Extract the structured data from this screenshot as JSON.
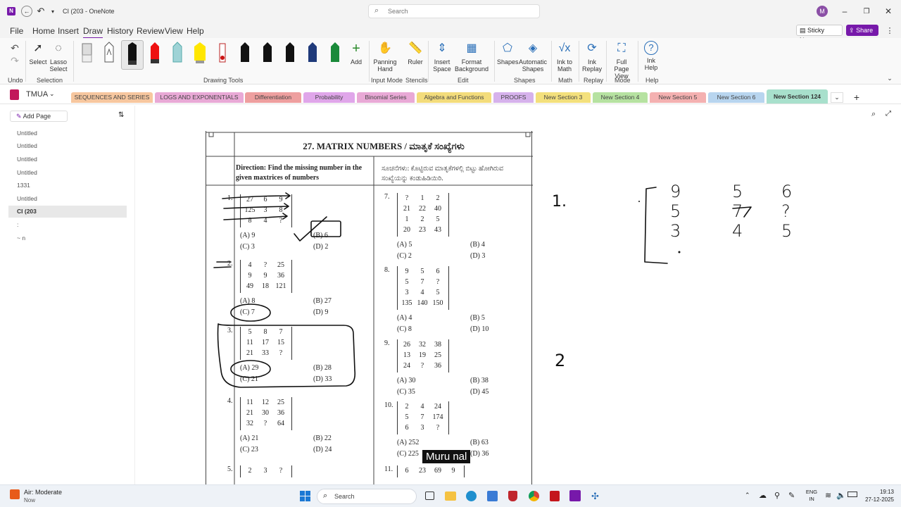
{
  "titlebar": {
    "app_title": "CI (203 - OneNote",
    "search_placeholder": "Search",
    "avatar_initial": "M"
  },
  "menu": {
    "items": [
      "File",
      "Home",
      "Insert",
      "Draw",
      "History",
      "Review",
      "View",
      "Help"
    ],
    "active": "Draw",
    "sticky_notes": "Sticky Notes",
    "share": "Share"
  },
  "ribbon": {
    "undo": "Undo",
    "select": "Select",
    "lasso": "Lasso Select",
    "selection_group": "Selection",
    "add": "Add",
    "drawing_tools_group": "Drawing Tools",
    "panning": "Panning Hand",
    "input_mode_group": "Input Mode",
    "ruler": "Ruler",
    "stencils_group": "Stencils",
    "insert_space": "Insert Space",
    "format_bg": "Format Background",
    "edit_group": "Edit",
    "shapes": "Shapes",
    "auto_shapes": "Automatic Shapes",
    "shapes_group": "Shapes",
    "ink_math": "Ink to Math",
    "math_group": "Math",
    "ink_replay": "Ink Replay",
    "replay_group": "Replay",
    "full_page": "Full Page View",
    "mode_group": "Mode",
    "ink_help": "Ink Help",
    "help_group": "Help"
  },
  "notebook": {
    "name": "TMUA",
    "sections": [
      {
        "label": "SEQUENCES AND SERIES",
        "color": "#f7c79f"
      },
      {
        "label": "LOGS AND EXPONENTIALS",
        "color": "#e9a9d6"
      },
      {
        "label": "Differentiation",
        "color": "#ee9f9f"
      },
      {
        "label": "Probability",
        "color": "#e0a6ea"
      },
      {
        "label": "Binomial Series",
        "color": "#e9a9d6"
      },
      {
        "label": "Algebra and Functions",
        "color": "#f3dc7b"
      },
      {
        "label": "PROOFS",
        "color": "#d6b2ec"
      },
      {
        "label": "New Section 3",
        "color": "#f3e07c"
      },
      {
        "label": "New Section 4",
        "color": "#b6e2a1"
      },
      {
        "label": "New Section 5",
        "color": "#f4b1b1"
      },
      {
        "label": "New Section 6",
        "color": "#b8d5ef"
      },
      {
        "label": "New Section 124",
        "color": "#a8e0cc"
      }
    ]
  },
  "pages": {
    "add_page": "Add Page",
    "items": [
      "Untitled",
      "Untitled",
      "Untitled",
      "Untitled",
      "1331",
      "Untitled",
      "CI (203",
      ":",
      "~ n"
    ],
    "selected_index": 6
  },
  "document": {
    "title": "27. MATRIX NUMBERS / ಮಾತೃಕೆ ಸಂಖ್ಯೆಗಳು",
    "direction_en": "Direction: Find the missing number in the given maxtrices of numbers",
    "direction_kn": "ಸೂಚನೆಗಳು: ಕೊಟ್ಟಿರುವ ಮಾತೃಕೆಗಳಲ್ಲಿ ಬಿಟ್ಟು ಹೋಗಿರುವ ಸಂಖ್ಯೆಯನ್ನು ಕಂಡುಹಿಡಿಯಿರಿ.",
    "left_questions": [
      {
        "num": "1.",
        "rows": [
          [
            "27",
            "6",
            "9"
          ],
          [
            "125",
            "3",
            "8"
          ],
          [
            "8",
            "4",
            "?"
          ]
        ],
        "options": [
          "(A) 9",
          "(B) 6",
          "(C) 3",
          "(D) 2"
        ]
      },
      {
        "num": "2.",
        "rows": [
          [
            "4",
            "?",
            "25"
          ],
          [
            "9",
            "9",
            "36"
          ],
          [
            "49",
            "18",
            "121"
          ]
        ],
        "options": [
          "(A) 8",
          "(B) 27",
          "(C) 7",
          "(D) 9"
        ]
      },
      {
        "num": "3.",
        "rows": [
          [
            "5",
            "8",
            "7"
          ],
          [
            "11",
            "17",
            "15"
          ],
          [
            "21",
            "33",
            "?"
          ]
        ],
        "options": [
          "(A) 29",
          "(B) 28",
          "(C) 21",
          "(D) 33"
        ]
      },
      {
        "num": "4.",
        "rows": [
          [
            "11",
            "12",
            "25"
          ],
          [
            "21",
            "30",
            "36"
          ],
          [
            "32",
            "?",
            "64"
          ]
        ],
        "options": [
          "(A) 21",
          "(B) 22",
          "(C) 23",
          "(D) 24"
        ]
      },
      {
        "num": "5.",
        "rows": [
          [
            "2",
            "3",
            "?"
          ]
        ],
        "options": []
      }
    ],
    "right_questions": [
      {
        "num": "7.",
        "rows": [
          [
            "?",
            "1",
            "2"
          ],
          [
            "21",
            "22",
            "40"
          ],
          [
            "1",
            "2",
            "5"
          ],
          [
            "20",
            "23",
            "43"
          ]
        ],
        "options": [
          "(A) 5",
          "(B) 4",
          "(C) 2",
          "(D) 3"
        ]
      },
      {
        "num": "8.",
        "rows": [
          [
            "9",
            "5",
            "6"
          ],
          [
            "5",
            "7",
            "?"
          ],
          [
            "3",
            "4",
            "5"
          ],
          [
            "135",
            "140",
            "150"
          ]
        ],
        "options": [
          "(A) 4",
          "(B) 5",
          "(C) 8",
          "(D) 10"
        ]
      },
      {
        "num": "9.",
        "rows": [
          [
            "26",
            "32",
            "38"
          ],
          [
            "13",
            "19",
            "25"
          ],
          [
            "24",
            "?",
            "36"
          ]
        ],
        "options": [
          "(A) 30",
          "(B) 38",
          "(C) 35",
          "(D) 45"
        ]
      },
      {
        "num": "10.",
        "rows": [
          [
            "2",
            "4",
            "24"
          ],
          [
            "5",
            "7",
            "174"
          ],
          [
            "6",
            "3",
            "?"
          ]
        ],
        "options": [
          "(A) 252",
          "(B) 63",
          "(C) 225",
          "(D) 36"
        ]
      },
      {
        "num": "11.",
        "rows": [
          [
            "6",
            "23",
            "69",
            "9"
          ]
        ],
        "options": []
      }
    ]
  },
  "handwriting": {
    "label1": "1.",
    "label2": "2",
    "matrix": [
      [
        "9",
        "5",
        "6"
      ],
      [
        "5",
        "7",
        "?"
      ],
      [
        "3",
        "4",
        "5"
      ]
    ]
  },
  "caption": "Muru nal",
  "taskbar": {
    "weather_title": "Air: Moderate",
    "weather_sub": "Now",
    "search": "Search",
    "lang_top": "ENG",
    "lang_bottom": "IN",
    "time": "19:13",
    "date": "27-12-2025"
  }
}
